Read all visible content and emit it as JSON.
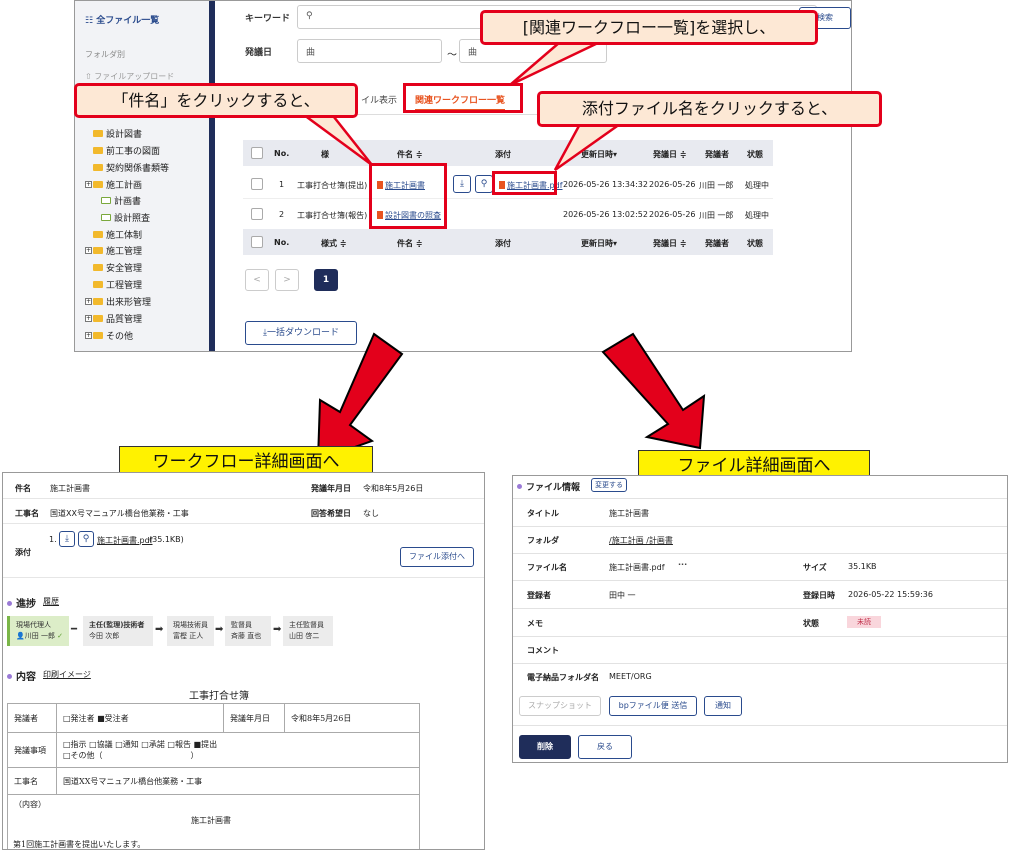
{
  "top": {
    "sidebar": {
      "all_files": "全ファイル一覧",
      "by_folder": "フォルダ別",
      "upload": "ファイルアップロード",
      "tree": [
        {
          "label": "設計図書",
          "type": "folder"
        },
        {
          "label": "前工事の図面",
          "type": "folder"
        },
        {
          "label": "契約関係書類等",
          "type": "folder"
        },
        {
          "label": "施工計画",
          "type": "folder-plus"
        },
        {
          "label": "計画書",
          "type": "open"
        },
        {
          "label": "設計照査",
          "type": "open"
        },
        {
          "label": "施工体制",
          "type": "folder"
        },
        {
          "label": "施工管理",
          "type": "folder-plus"
        },
        {
          "label": "安全管理",
          "type": "folder"
        },
        {
          "label": "工程管理",
          "type": "folder"
        },
        {
          "label": "出来形管理",
          "type": "folder-plus"
        },
        {
          "label": "品質管理",
          "type": "folder-plus"
        },
        {
          "label": "その他",
          "type": "folder-plus"
        }
      ]
    },
    "search": {
      "keyword_label": "キーワード",
      "date_label": "発議日",
      "date_from_placeholder": "曲",
      "date_to_placeholder": "曲",
      "tilde": "〜",
      "search_button": "検索"
    },
    "tabs": {
      "file_view_partial": "イル表示",
      "related_workflow": "関連ワークフロー一覧"
    },
    "table": {
      "headers": [
        "No.",
        "様式",
        "件名",
        "添付",
        "更新日時",
        "発議日",
        "発議者",
        "状態"
      ],
      "rows": [
        {
          "no": "1",
          "style": "工事打合せ簿(提出)",
          "subject": "施工計画書",
          "attachment": "施工計画書.pdf",
          "updated": "2026-05-26 13:34:32",
          "date": "2026-05-26",
          "author": "川田 一郎",
          "status": "処理中"
        },
        {
          "no": "2",
          "style": "工事打合せ簿(報告)",
          "subject": "設計図書の照査",
          "attachment": "",
          "updated": "2026-05-26 13:02:52",
          "date": "2026-05-26",
          "author": "川田 一郎",
          "status": "処理中"
        }
      ],
      "sort_marks": {
        "subject": "件名 ≑",
        "updated": "更新日時▾",
        "date": "発議日 ≑",
        "style": "様式 ≑"
      }
    },
    "pagination": {
      "prev": "<",
      "next": ">",
      "current": "1"
    },
    "bulk_download": "一括ダウンロード"
  },
  "callouts": {
    "select_related": "[関連ワークフロー一覧]を選択し、",
    "click_subject": "「件名」をクリックすると、",
    "click_attachment": "添付ファイル名をクリックすると、",
    "to_workflow_detail": "ワークフロー詳細画面へ",
    "to_file_detail": "ファイル詳細画面へ"
  },
  "workflow_detail": {
    "subject_label": "件名",
    "subject": "施工計画書",
    "date_label": "発議年月日",
    "date": "令和8年5月26日",
    "project_label": "工事名",
    "project": "国道XX号マニュアル橋台他業務・工事",
    "reply_label": "回答希望日",
    "reply": "なし",
    "attach_label": "添付",
    "attach_index": "1.",
    "attach_file": "施工計画書.pdf",
    "attach_size": "(35.1KB)",
    "attach_button": "ファイル添付へ",
    "progress_title": "進捗",
    "history_link": "履歴",
    "steps": [
      {
        "role": "現場代理人",
        "name": "川田 一郎"
      },
      {
        "role": "主任(監理)技術者",
        "name": "今田 次郎"
      },
      {
        "role": "現場技術員",
        "name": "富樫 正人"
      },
      {
        "role": "監督員",
        "name": "斉藤 直也"
      },
      {
        "role": "主任監督員",
        "name": "山田 啓二"
      }
    ],
    "content_title": "内容",
    "print_link": "印刷イメージ",
    "form_title": "工事打合せ簿",
    "form": {
      "issuer_label": "発議者",
      "issuer_value": "□発注者 ■受注者",
      "date_label": "発議年月日",
      "date_value": "令和8年5月26日",
      "matter_label": "発議事項",
      "matter_line1": "□指示 □協議 □通知 □承諾 □報告 ■提出",
      "matter_line2": "□その他（　　　　　　　　　　　）",
      "project_label": "工事名",
      "project_value": "国道XX号マニュアル橋台他業務・工事",
      "content_label": "（内容）",
      "content_heading": "施工計画書",
      "content_text": "第1回施工計画書を提出いたします。"
    }
  },
  "file_detail": {
    "title": "ファイル情報",
    "change_button": "変更する",
    "rows": {
      "title_label": "タイトル",
      "title_value": "施工計画書",
      "folder_label": "フォルダ",
      "folder_value": "/施工計画 /計画書",
      "filename_label": "ファイル名",
      "filename_value": "施工計画書.pdf",
      "more": "···",
      "size_label": "サイズ",
      "size_value": "35.1KB",
      "registrant_label": "登録者",
      "registrant_value": "田中 一",
      "registered_label": "登録日時",
      "registered_value": "2026-05-22 15:59:36",
      "memo_label": "メモ",
      "status_label": "状態",
      "status_value": "未読",
      "comment_label": "コメント",
      "efolder_label": "電子納品フォルダ名",
      "efolder_value": "MEET/ORG"
    },
    "buttons": {
      "snapshot": "スナップショット",
      "bp_send": "bpファイル便 送信",
      "notify": "通知",
      "delete": "削除",
      "back": "戻る"
    }
  },
  "colors": {
    "red": "#e3001b",
    "navy": "#1f2d5a",
    "link": "#2a4b8d",
    "callout_bg": "#fde8d5",
    "yellow": "#fff200"
  }
}
